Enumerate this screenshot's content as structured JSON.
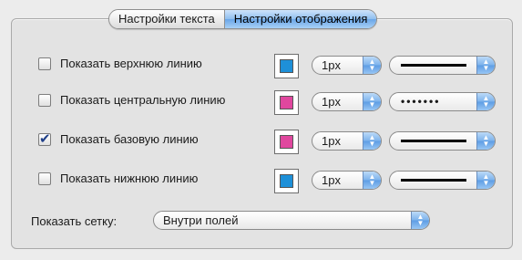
{
  "tabs": [
    {
      "label": "Настройки текста",
      "active": false
    },
    {
      "label": "Настройки отображения",
      "active": true
    }
  ],
  "lines": [
    {
      "label": "Показать верхнюю линию",
      "checked": false,
      "color": "#1e90d8",
      "size": "1px",
      "style": "solid"
    },
    {
      "label": "Показать центральную линию",
      "checked": false,
      "color": "#e0479e",
      "size": "1px",
      "style": "dotted"
    },
    {
      "label": "Показать базовую линию",
      "checked": true,
      "color": "#e0479e",
      "size": "1px",
      "style": "solid"
    },
    {
      "label": "Показать нижнюю линию",
      "checked": false,
      "color": "#1e90d8",
      "size": "1px",
      "style": "solid"
    }
  ],
  "grid": {
    "label": "Показать сетку:",
    "value": "Внутри полей"
  },
  "icons": {
    "checkmark": "✔",
    "popup_arrows": "▲▼",
    "dots": "•••••••"
  }
}
